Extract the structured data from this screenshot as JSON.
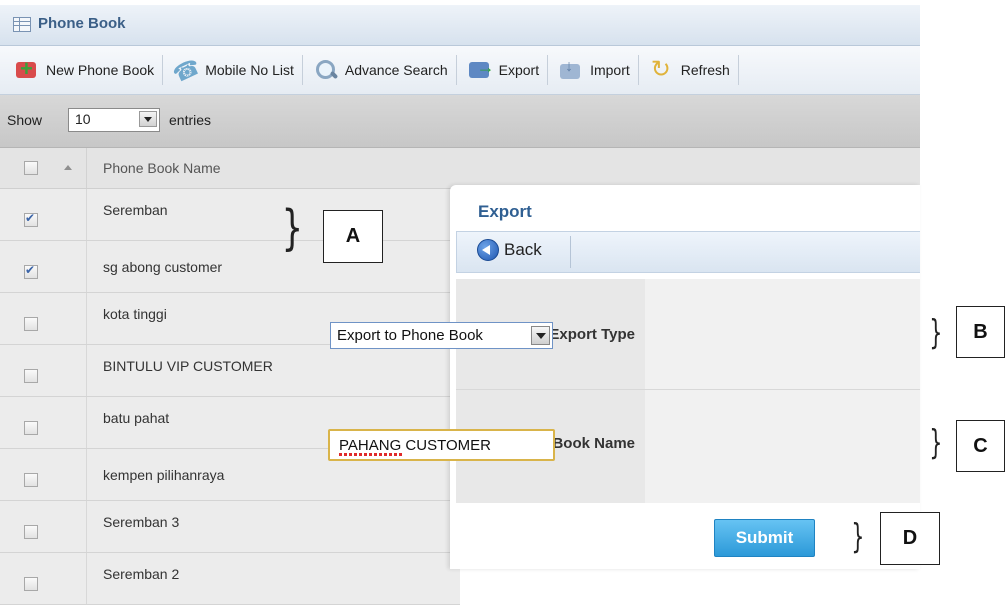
{
  "window": {
    "title": "Phone Book"
  },
  "toolbar": {
    "buttons": [
      {
        "label": "New Phone Book",
        "icon": "new-phone-book-icon"
      },
      {
        "label": "Mobile No List",
        "icon": "phone-icon"
      },
      {
        "label": "Advance Search",
        "icon": "search-icon"
      },
      {
        "label": "Export",
        "icon": "export-icon"
      },
      {
        "label": "Import",
        "icon": "import-icon"
      },
      {
        "label": "Refresh",
        "icon": "refresh-icon"
      }
    ]
  },
  "entries": {
    "show_label": "Show",
    "value": "10",
    "suffix": "entries"
  },
  "table": {
    "header": "Phone Book Name",
    "rows": [
      {
        "name": "Seremban",
        "checked": true
      },
      {
        "name": "sg abong customer",
        "checked": true
      },
      {
        "name": "kota tinggi",
        "checked": false
      },
      {
        "name": "BINTULU VIP CUSTOMER",
        "checked": false
      },
      {
        "name": "batu pahat",
        "checked": false
      },
      {
        "name": "kempen pilihanraya",
        "checked": false
      },
      {
        "name": "Seremban 3",
        "checked": false
      },
      {
        "name": "Seremban 2",
        "checked": false
      }
    ]
  },
  "dialog": {
    "title": "Export",
    "back_label": "Back",
    "export_type_label": "Export Type",
    "export_type_value": "Export to Phone Book",
    "phone_book_name_label": "Phone Book Name",
    "phone_book_name_value": "PAHANG CUSTOMER",
    "submit_label": "Submit"
  },
  "annotations": {
    "a": "A",
    "b": "B",
    "c": "C",
    "d": "D"
  },
  "colors": {
    "title_text": "#3b5f87",
    "dialog_title": "#2f5f92",
    "submit_bg": "#2c99d8",
    "input_border": "#d9b44a",
    "select_border": "#6f93c6"
  }
}
